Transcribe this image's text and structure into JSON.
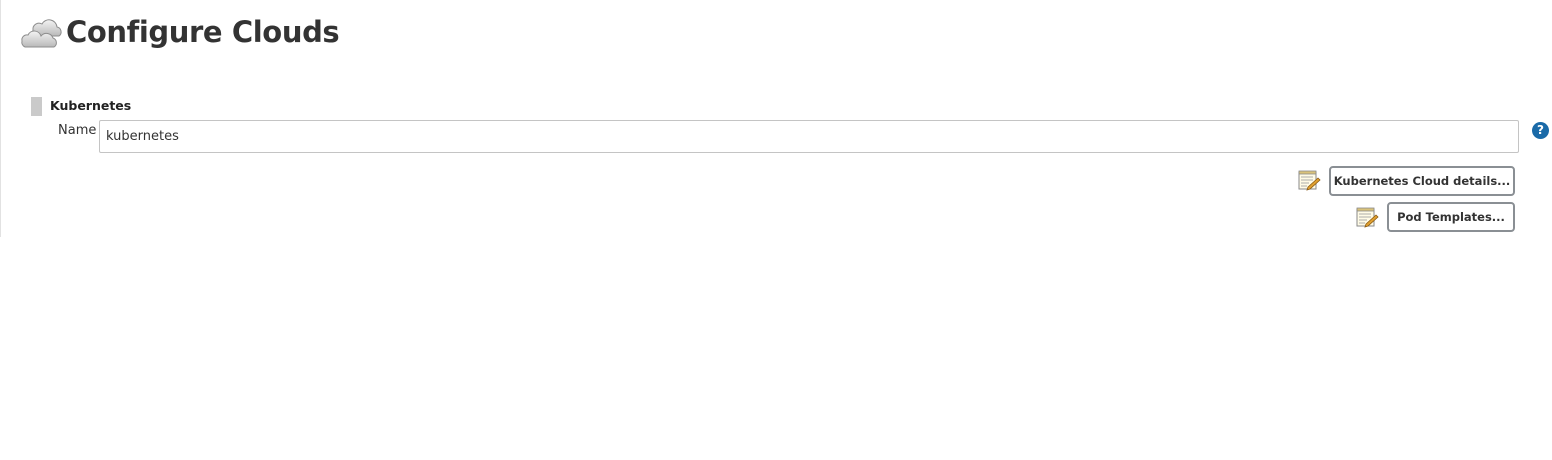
{
  "header": {
    "title": "Configure Clouds",
    "icon": "clouds-icon"
  },
  "cloud": {
    "section_title": "Kubernetes",
    "name_label": "Name",
    "name_value": "kubernetes",
    "help_symbol": "?",
    "buttons": {
      "details_label": "Kubernetes Cloud details...",
      "pod_templates_label": "Pod Templates..."
    }
  },
  "icons": {
    "drag_handle": "drag-handle-icon",
    "help": "help-icon",
    "edit_notepad": "notepad-edit-icon"
  },
  "colors": {
    "help_icon_bg": "#1a6aa8",
    "button_border": "#8a8f94",
    "text": "#333333"
  }
}
